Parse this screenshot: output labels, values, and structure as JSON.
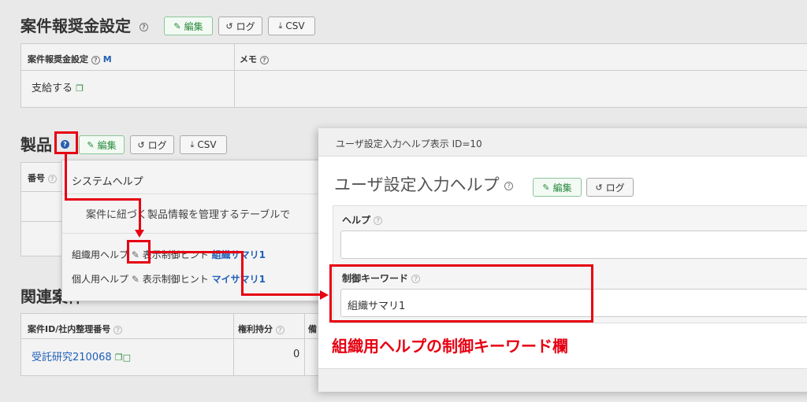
{
  "labels": {
    "edit": "編集",
    "log": "ログ",
    "csv": "CSV",
    "help_mark": "?"
  },
  "section_reward": {
    "title": "案件報奨金設定",
    "col_setting": "案件報奨金設定",
    "col_setting_flag": "M",
    "col_memo": "メモ",
    "value_setting": "支給する"
  },
  "section_products": {
    "title": "製品",
    "col_number": "番号"
  },
  "section_related": {
    "title": "関連案件",
    "col_id": "案件ID/社内整理番号",
    "col_share": "権利持分",
    "col_note": "備",
    "row_id": "受託研究210068",
    "row_share": "0"
  },
  "popover": {
    "title": "システムヘルプ",
    "description": "案件に紐づく製品情報を管理するテーブルで",
    "org_label": "組織用ヘルプ",
    "hint_label": "表示制御ヒント",
    "org_link": "組織サマリ1",
    "personal_label": "個人用ヘルプ",
    "personal_link": "マイサマリ1"
  },
  "modal": {
    "header": "ユーザ設定入力ヘルプ表示 ID=10",
    "title": "ユーザ設定入力ヘルプ",
    "help_label": "ヘルプ",
    "help_value": "",
    "keyword_label": "制御キーワード",
    "keyword_value": "組織サマリ1"
  },
  "annotation": "組織用ヘルプの制御キーワード欄",
  "colors": {
    "red": "#e60012",
    "link": "#1f5fb8",
    "green": "#2a8a3e"
  }
}
